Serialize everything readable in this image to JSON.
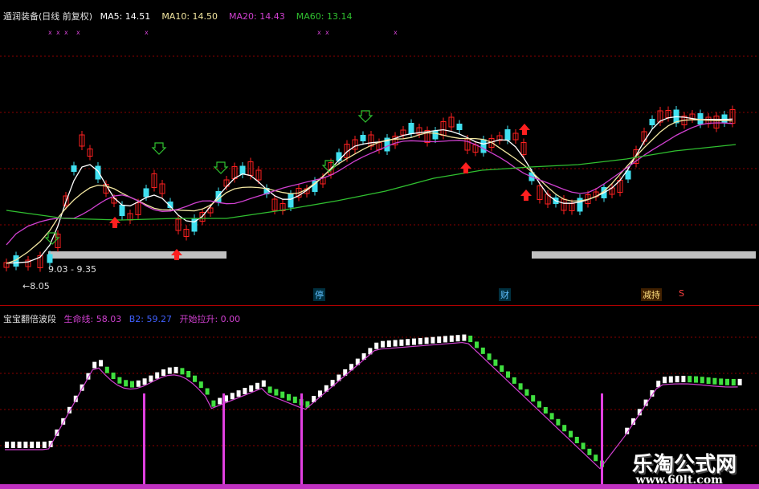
{
  "top_panel": {
    "indicator_name": "遁润装备(日线 前复权)",
    "ma_labels": [
      {
        "text": "MA5: 14.51",
        "color": "#ffffff"
      },
      {
        "text": "MA10: 14.50",
        "color": "#f2e6a0"
      },
      {
        "text": "MA20: 14.43",
        "color": "#d040d0"
      },
      {
        "text": "MA60: 13.14",
        "color": "#30c030"
      }
    ],
    "price_range_label": "9.03 - 9.35",
    "low_price_label": "←8.05",
    "event_badges": [
      "停",
      "财",
      "减持",
      "S"
    ]
  },
  "bottom_panel": {
    "indicator_name": "宝宝翻倍波段",
    "life_line_label": "生命线: 58.03",
    "b2_label": "B2: 59.27",
    "start_pull_label": "开始拉升: 0.00"
  },
  "watermark": {
    "title": "乐淘公式网",
    "url": "www.60lt.com"
  },
  "colors": {
    "up": "#ff2020",
    "down": "#40e0f0",
    "ma5": "#ffffff",
    "ma10": "#f2e6a0",
    "ma20": "#d040d0",
    "ma60": "#30c030",
    "histo_up": "#ffffff",
    "histo_down": "#40e040",
    "grid": "#8b0000",
    "zone": "#c0c0c0"
  }
}
